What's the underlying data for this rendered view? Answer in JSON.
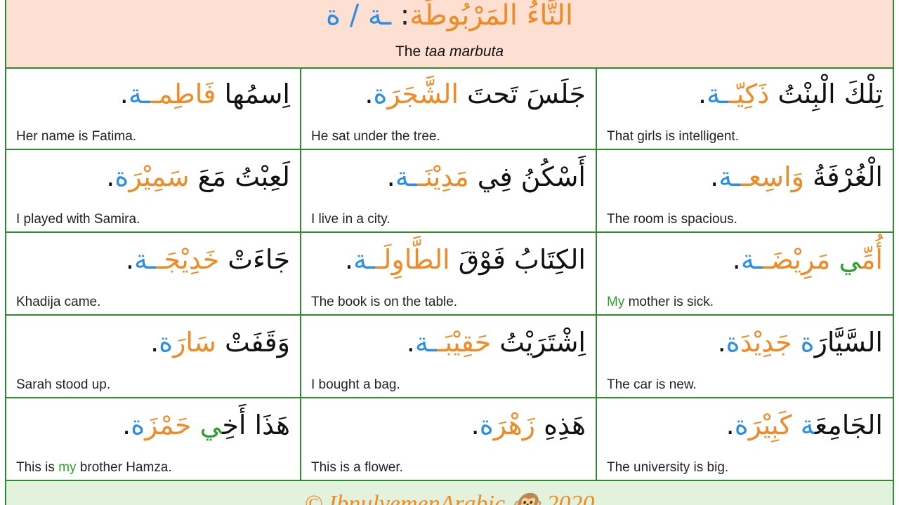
{
  "header": {
    "title_main": "التَّاءُ المَرْبُوطَة",
    "title_sep": ": ",
    "title_forms": "ـة / ة",
    "subtitle_prefix": "The ",
    "subtitle_italic": "taa marbuta"
  },
  "cells": [
    {
      "ar": [
        [
          "تِلْكَ الْبِنْتُ ",
          ""
        ],
        [
          "ذَكِيّـ",
          "o"
        ],
        [
          "ـة",
          "b"
        ],
        [
          ".",
          ""
        ]
      ],
      "en": [
        [
          "That girls is intelligent.",
          ""
        ]
      ]
    },
    {
      "ar": [
        [
          "جَلَسَ تَحتَ ",
          ""
        ],
        [
          "الشَّجَرَ",
          "o"
        ],
        [
          "ة",
          "b"
        ],
        [
          ".",
          ""
        ]
      ],
      "en": [
        [
          "He sat under the tree.",
          ""
        ]
      ]
    },
    {
      "ar": [
        [
          "اِسمُها ",
          ""
        ],
        [
          "فَاطِمـ",
          "o"
        ],
        [
          "ـة",
          "b"
        ],
        [
          ".",
          ""
        ]
      ],
      "en": [
        [
          "Her name is Fatima.",
          ""
        ]
      ]
    },
    {
      "ar": [
        [
          "الْغُرْفَةُ ",
          ""
        ],
        [
          "وَاسِعـ",
          "o"
        ],
        [
          "ـة",
          "b"
        ],
        [
          ".",
          ""
        ]
      ],
      "en": [
        [
          "The room is spacious.",
          ""
        ]
      ]
    },
    {
      "ar": [
        [
          "أَسْكُنُ فِي ",
          ""
        ],
        [
          "مَدِيْنَـ",
          "o"
        ],
        [
          "ـة",
          "b"
        ],
        [
          ".",
          ""
        ]
      ],
      "en": [
        [
          "I live in a city.",
          ""
        ]
      ]
    },
    {
      "ar": [
        [
          "لَعِبْتُ مَعَ ",
          ""
        ],
        [
          "سَمِيْرَ",
          "o"
        ],
        [
          "ة",
          "b"
        ],
        [
          ".",
          ""
        ]
      ],
      "en": [
        [
          "I played with Samira.",
          ""
        ]
      ]
    },
    {
      "ar": [
        [
          "أُمِّ",
          "o"
        ],
        [
          "ي ",
          "g"
        ],
        [
          "مَرِيْضَـ",
          "o"
        ],
        [
          "ـة",
          "b"
        ],
        [
          ".",
          ""
        ]
      ],
      "en": [
        [
          "My",
          "g"
        ],
        [
          " mother is sick.",
          ""
        ]
      ]
    },
    {
      "ar": [
        [
          "الكِتَابُ فَوْقَ ",
          ""
        ],
        [
          "الطَّاوِلَـ",
          "o"
        ],
        [
          "ـة",
          "b"
        ],
        [
          ".",
          ""
        ]
      ],
      "en": [
        [
          "The book is on the table.",
          ""
        ]
      ]
    },
    {
      "ar": [
        [
          "جَاءَتْ ",
          ""
        ],
        [
          "خَدِيْجَـ",
          "o"
        ],
        [
          "ـة",
          "b"
        ],
        [
          ".",
          ""
        ]
      ],
      "en": [
        [
          "Khadija came.",
          ""
        ]
      ]
    },
    {
      "ar": [
        [
          "السَّيَّارَ",
          ""
        ],
        [
          "ة",
          "b"
        ],
        [
          " جَدِيْدَ",
          "o"
        ],
        [
          "ة",
          "b"
        ],
        [
          ".",
          ""
        ]
      ],
      "en": [
        [
          "The car is new.",
          ""
        ]
      ]
    },
    {
      "ar": [
        [
          "اِشْتَرَيْتُ ",
          ""
        ],
        [
          "حَقِيْبَـ",
          "o"
        ],
        [
          "ـة",
          "b"
        ],
        [
          ".",
          ""
        ]
      ],
      "en": [
        [
          "I bought a bag.",
          ""
        ]
      ]
    },
    {
      "ar": [
        [
          "وَقَفَتْ ",
          ""
        ],
        [
          "سَارَ",
          "o"
        ],
        [
          "ة",
          "b"
        ],
        [
          ".",
          ""
        ]
      ],
      "en": [
        [
          "Sarah stood up.",
          ""
        ]
      ]
    },
    {
      "ar": [
        [
          "الجَامِعَ",
          ""
        ],
        [
          "ة",
          "b"
        ],
        [
          " كَبِيْرَ",
          "o"
        ],
        [
          "ة",
          "b"
        ],
        [
          ".",
          ""
        ]
      ],
      "en": [
        [
          "The university is big.",
          ""
        ]
      ]
    },
    {
      "ar": [
        [
          "هَذِهِ ",
          ""
        ],
        [
          "زَهْرَ",
          "o"
        ],
        [
          "ة",
          "b"
        ],
        [
          ".",
          ""
        ]
      ],
      "en": [
        [
          "This is a flower.",
          ""
        ]
      ]
    },
    {
      "ar": [
        [
          "هَذَا أَخِ",
          ""
        ],
        [
          "ي ",
          "g"
        ],
        [
          "حَمْزَ",
          "o"
        ],
        [
          "ة",
          "b"
        ],
        [
          ".",
          ""
        ]
      ],
      "en": [
        [
          "This is ",
          ""
        ],
        [
          "my",
          "g"
        ],
        [
          " brother Hamza.",
          ""
        ]
      ]
    }
  ],
  "footer": {
    "text": "© IbnulyemenArabic 🐵 2020"
  },
  "colors": {
    "border": "#2e8b2e",
    "header_bg": "#fde0d2",
    "footer_bg": "#e3f2dc",
    "orange": "#f08a24",
    "blue": "#2a8de8",
    "green": "#2e9e2e"
  }
}
